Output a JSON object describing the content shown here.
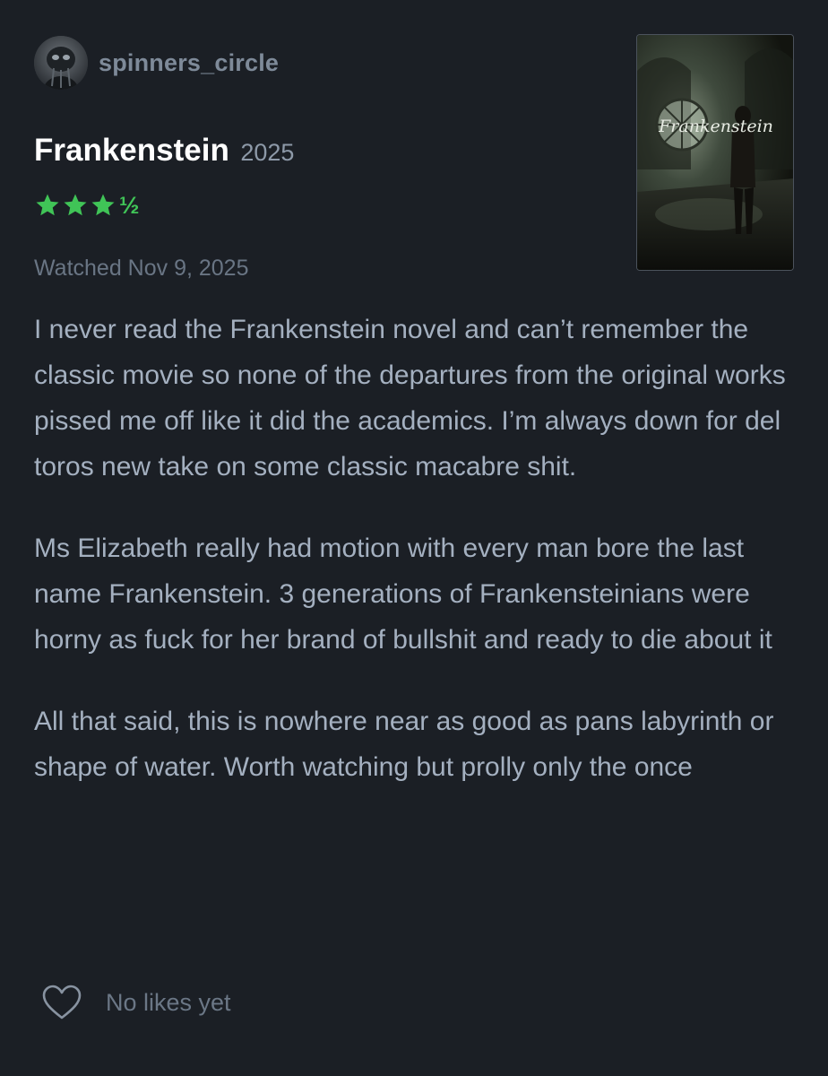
{
  "user": {
    "username": "spinners_circle",
    "avatar_icon": "avatar-image"
  },
  "film": {
    "title": "Frankenstein",
    "year": "2025",
    "poster_title": "Frankenstein"
  },
  "rating": {
    "stars": 3.5,
    "max": 5,
    "full_star_glyph": "★",
    "half_glyph": "½",
    "color": "#40c457"
  },
  "watched": "Watched Nov 9, 2025",
  "review": {
    "paragraphs": [
      "I never read the Frankenstein novel and can’t remember the classic movie so none of the departures from the original works pissed me off like it did the academics. I’m always down for del toros new take on some classic macabre shit.",
      "Ms Elizabeth really had motion with every man bore the last name Frankenstein. 3 generations of Frankensteinians were horny as fuck for her brand of bullshit and ready to die about it",
      "All that said, this is nowhere near as good as pans labyrinth or shape of water. Worth watching but prolly only the once"
    ]
  },
  "likes": {
    "icon": "heart-icon",
    "text": "No likes yet"
  },
  "colors": {
    "background": "#1b1f25",
    "title": "#ffffff",
    "body_text": "#a4b0c0",
    "muted_text": "#697584",
    "rating_green": "#40c457"
  }
}
